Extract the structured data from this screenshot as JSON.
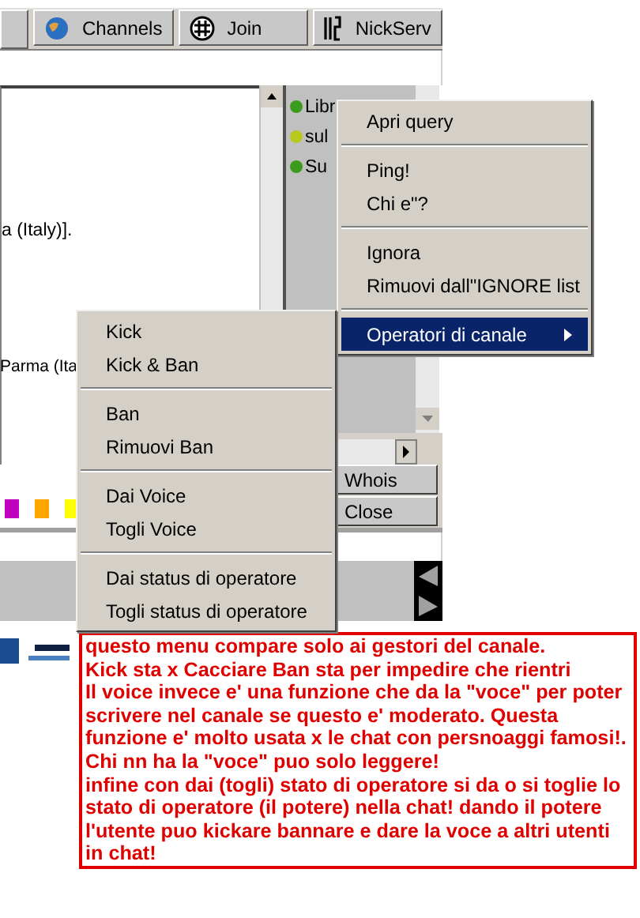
{
  "toolbar": [
    {
      "kind": "globe",
      "label": "Channels"
    },
    {
      "kind": "grid",
      "label": "Join"
    },
    {
      "kind": "bars",
      "label": "NickServ"
    }
  ],
  "chat_lines": [
    "a (Italy)].",
    "Parma (Ita"
  ],
  "nick_list": [
    {
      "name": "Libr",
      "color": "#3c9a1c"
    },
    {
      "name": "sul",
      "color": "#b8c81c"
    },
    {
      "name": "Su",
      "color": "#3c9a1c"
    }
  ],
  "color_swatches": [
    {
      "color": "#c000c0"
    },
    {
      "color": "#ffa500"
    },
    {
      "color": "#ffff00"
    }
  ],
  "buttons": [
    "Whois",
    "Close"
  ],
  "context_menu": [
    {
      "kind": "item",
      "label": "Apri query",
      "selected": false
    },
    {
      "kind": "separator"
    },
    {
      "kind": "item",
      "label": "Ping!",
      "selected": false
    },
    {
      "kind": "item",
      "label": "Chi e\"?",
      "selected": false
    },
    {
      "kind": "separator"
    },
    {
      "kind": "item",
      "label": "Ignora",
      "selected": false
    },
    {
      "kind": "item",
      "label": "Rimuovi dall\"IGNORE list",
      "selected": false
    },
    {
      "kind": "separator"
    },
    {
      "kind": "submenu",
      "label": "Operatori di canale",
      "selected": true
    }
  ],
  "submenu": [
    {
      "kind": "item",
      "label": "Kick"
    },
    {
      "kind": "item",
      "label": "Kick & Ban"
    },
    {
      "kind": "separator"
    },
    {
      "kind": "item",
      "label": "Ban"
    },
    {
      "kind": "item",
      "label": "Rimuovi Ban"
    },
    {
      "kind": "separator"
    },
    {
      "kind": "item",
      "label": "Dai Voice"
    },
    {
      "kind": "item",
      "label": "Togli Voice"
    },
    {
      "kind": "separator"
    },
    {
      "kind": "item",
      "label": "Dai status di operatore"
    },
    {
      "kind": "item",
      "label": "Togli status di operatore"
    }
  ],
  "annotation": [
    "questo menu compare solo ai gestori del canale.",
    "Kick sta x Cacciare Ban sta per impedire che rientri",
    "Il voice invece e' una funzione che da la \"voce\" per poter scrivere nel canale se questo e' moderato. Questa funzione e' molto usata x le chat con persnoaggi famosi!. Chi nn ha la \"voce\" puo solo leggere!",
    "infine con dai (togli) stato di operatore si da o si toglie lo stato di operatore (il potere) nella chat! dando il potere l'utente puo kickare bannare e dare la voce a altri utenti in chat!"
  ]
}
